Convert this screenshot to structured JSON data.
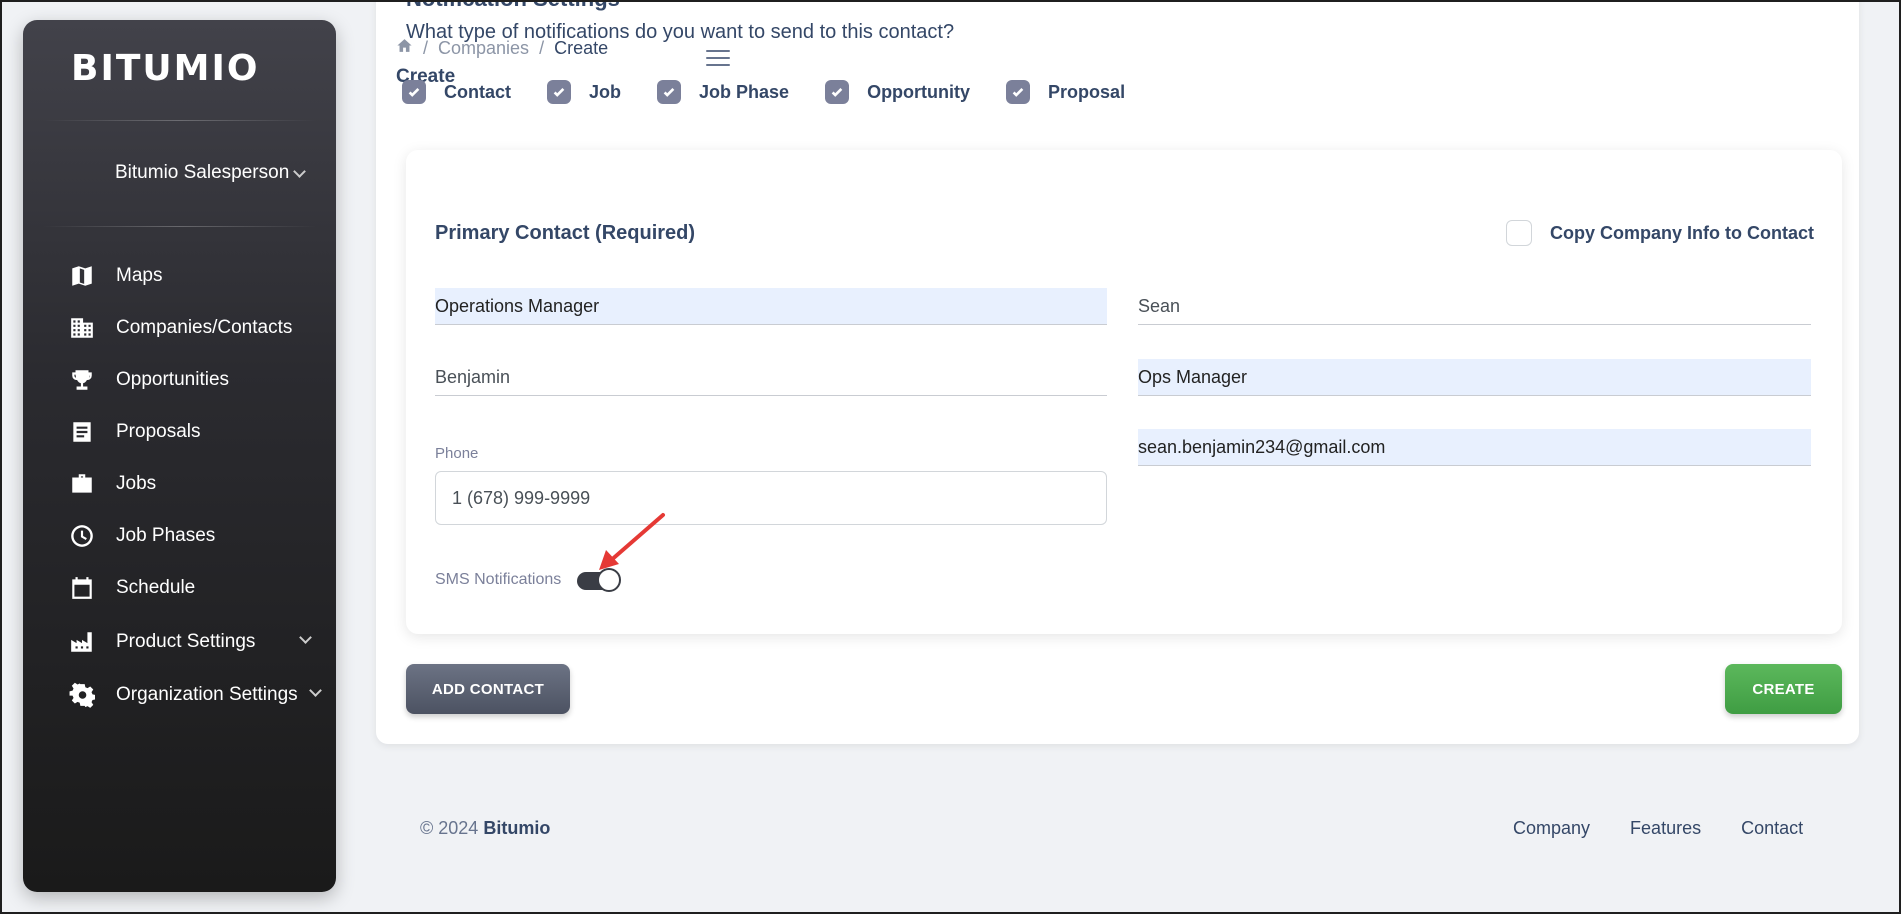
{
  "sidebar": {
    "logo": "BITUMIO",
    "user": "Bitumio Salesperson",
    "items": [
      {
        "label": "Maps",
        "icon": "map-icon"
      },
      {
        "label": "Companies/Contacts",
        "icon": "building-icon"
      },
      {
        "label": "Opportunities",
        "icon": "trophy-icon"
      },
      {
        "label": "Proposals",
        "icon": "document-icon"
      },
      {
        "label": "Jobs",
        "icon": "briefcase-icon"
      },
      {
        "label": "Job Phases",
        "icon": "clock-icon"
      },
      {
        "label": "Schedule",
        "icon": "calendar-icon"
      },
      {
        "label": "Product Settings",
        "icon": "factory-icon"
      },
      {
        "label": "Organization Settings",
        "icon": "gear-icon"
      }
    ]
  },
  "header": {
    "breadcrumb_sep": "/",
    "breadcrumb_companies": "Companies",
    "breadcrumb_current": "Create",
    "page_title": "Create"
  },
  "notifications": {
    "title": "Notification Settings",
    "question": "What type of notifications do you want to send to this contact?",
    "options": [
      "Contact",
      "Job",
      "Job Phase",
      "Opportunity",
      "Proposal"
    ]
  },
  "contact": {
    "title": "Primary Contact (Required)",
    "copy_label": "Copy Company Info to Contact",
    "field_title": "Operations Manager",
    "field_first": "Sean",
    "field_last": "Benjamin",
    "field_position": "Ops Manager",
    "field_email": "sean.benjamin234@gmail.com",
    "phone_label": "Phone",
    "phone_value": "1 (678) 999-9999",
    "sms_label": "SMS Notifications",
    "sms_enabled": true
  },
  "buttons": {
    "add_contact": "ADD CONTACT",
    "create": "CREATE"
  },
  "footer": {
    "copyright": "© 2024",
    "brand": "Bitumio",
    "links": [
      "Company",
      "Features",
      "Contact"
    ]
  },
  "colors": {
    "accent_green": "#4caf50",
    "sidebar_dark": "#1a1a1a",
    "text_dark": "#344767",
    "arrow_red": "#e53935"
  }
}
